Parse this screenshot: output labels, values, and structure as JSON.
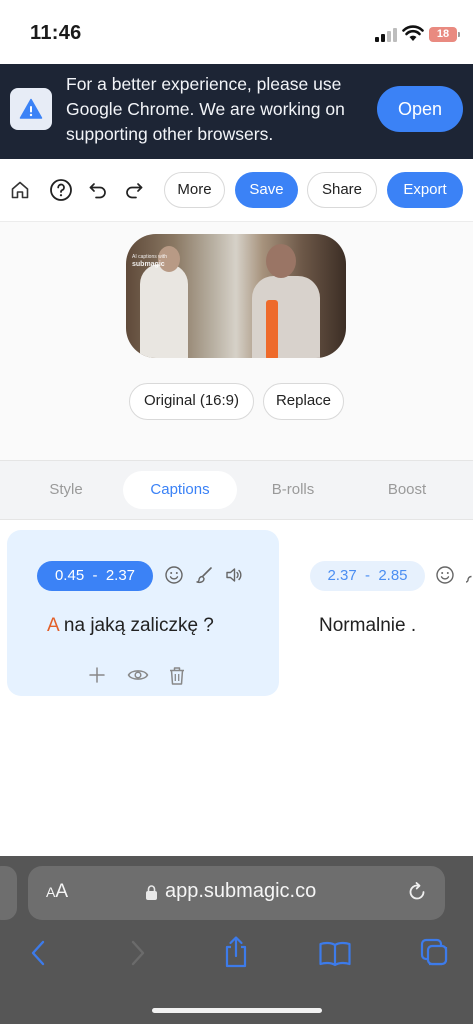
{
  "status_bar": {
    "time": "11:46",
    "battery": "18"
  },
  "banner": {
    "message": "For a better experience, please use Google Chrome. We are working on supporting other browsers.",
    "open_label": "Open",
    "icon": "warning-icon"
  },
  "toolbar": {
    "icons": [
      "home-icon",
      "help-icon",
      "undo-icon",
      "redo-icon"
    ],
    "more_label": "More",
    "save_label": "Save",
    "share_label": "Share",
    "export_label": "Export"
  },
  "preview": {
    "watermark_line1": "AI captions with",
    "watermark_brand": "submagic",
    "original_label": "Original (16:9)",
    "replace_label": "Replace"
  },
  "tabs": [
    {
      "label": "Style",
      "active": false
    },
    {
      "label": "Captions",
      "active": true
    },
    {
      "label": "B-rolls",
      "active": false
    },
    {
      "label": "Boost",
      "active": false
    }
  ],
  "captions": [
    {
      "time": "0.45  -  2.37",
      "highlight": "A",
      "text": " na jaką zaliczkę ?",
      "active": true
    },
    {
      "time": "2.37  -  2.85",
      "highlight": "",
      "text": "Normalnie .",
      "active": false
    }
  ],
  "browser": {
    "text_size_label_small": "A",
    "text_size_label_large": "A",
    "url": "app.submagic.co"
  },
  "colors": {
    "accent": "#3b82f6",
    "banner_bg": "#1d2535",
    "highlight_word": "#e2602a"
  }
}
